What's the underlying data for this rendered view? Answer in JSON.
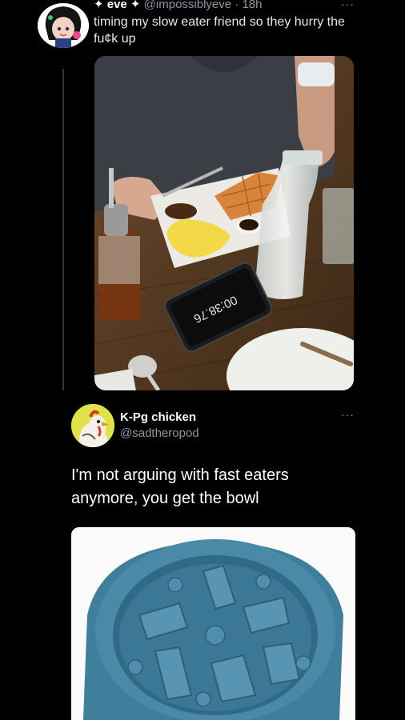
{
  "tweet1": {
    "display_name": "✦ eve ✦",
    "handle": "@impossiblyeve",
    "separator": "·",
    "time": "18h",
    "text": "timing my slow eater friend so they hurry the fu¢k up",
    "more": "···",
    "photo": {
      "stopwatch_reading": "00:38.76"
    }
  },
  "tweet2": {
    "display_name": "K-Pg chicken",
    "handle": "@sadtheropod",
    "more": "···",
    "text": "I'm not arguing with fast eaters anymore, you get the bowl"
  },
  "colors": {
    "background": "#000000",
    "text": "#e7e9ea",
    "muted": "#8b98a5",
    "bowl": "#4a8aa6"
  }
}
